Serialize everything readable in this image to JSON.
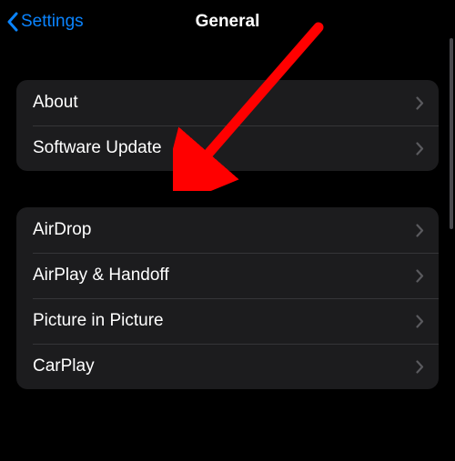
{
  "nav": {
    "back_label": "Settings",
    "title": "General"
  },
  "groups": [
    {
      "rows": [
        {
          "label": "About",
          "name": "row-about"
        },
        {
          "label": "Software Update",
          "name": "row-software-update"
        }
      ]
    },
    {
      "rows": [
        {
          "label": "AirDrop",
          "name": "row-airdrop"
        },
        {
          "label": "AirPlay & Handoff",
          "name": "row-airplay-handoff"
        },
        {
          "label": "Picture in Picture",
          "name": "row-picture-in-picture"
        },
        {
          "label": "CarPlay",
          "name": "row-carplay"
        }
      ]
    }
  ],
  "annotation": {
    "arrow_color": "#ff0000"
  }
}
